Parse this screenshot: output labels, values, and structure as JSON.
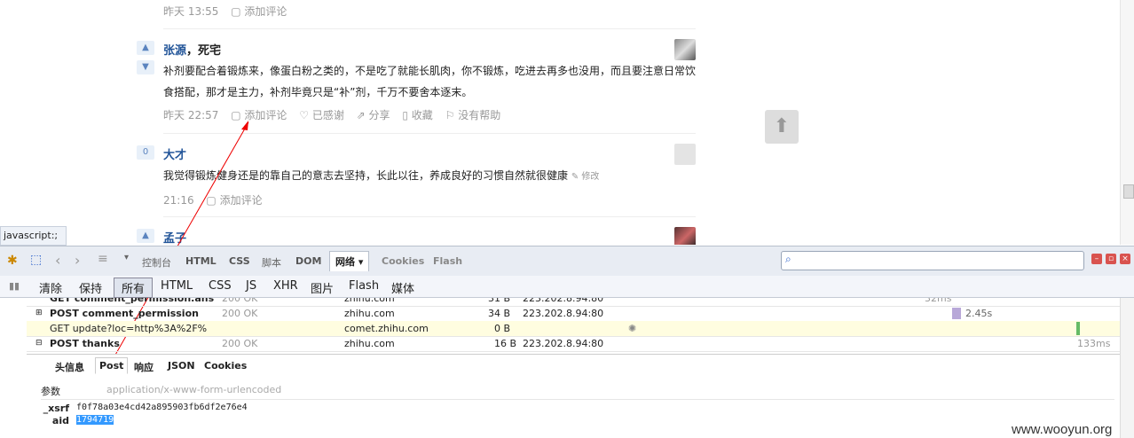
{
  "answers": [
    {
      "time": "昨天 13:55",
      "add_comment": "添加评论"
    },
    {
      "vote": "",
      "author": "张源",
      "bio": "，死宅",
      "text": "补剂要配合着锻炼来，像蛋白粉之类的，不是吃了就能长肌肉，你不锻炼，吃进去再多也没用，而且要注意日常饮食搭配，那才是主力，补剂毕竟只是“补”剂，千万不要舍本逐末。",
      "time": "昨天 22:57",
      "add_comment": "添加评论",
      "thanked": "已感谢",
      "share": "分享",
      "collect": "收藏",
      "no_help": "没有帮助"
    },
    {
      "vote": "0",
      "author": "大才",
      "text": "我觉得锻炼健身还是的靠自己的意志去坚持，长此以往，养成良好的习惯自然就很健康",
      "edit": "修改",
      "time": "21:16",
      "add_comment": "添加评论"
    },
    {
      "author": "孟子"
    }
  ],
  "status_bar": "javascript:;",
  "firebug": {
    "tabs": [
      "控制台",
      "HTML",
      "CSS",
      "脚本",
      "DOM",
      "网络",
      "Cookies",
      "Flash"
    ],
    "active_tab": "网络",
    "net_filters": [
      "清除",
      "保持",
      "所有",
      "HTML",
      "CSS",
      "JS",
      "XHR",
      "图片",
      "Flash",
      "媒体"
    ],
    "active_filter": "所有",
    "requests": [
      {
        "url": "GET comment_permission.ans",
        "status": "200 OK",
        "domain": "zhihu.com",
        "size": "31 B",
        "ip": "223.202.8.94:80",
        "time": "32ms"
      },
      {
        "url": "POST comment_permission",
        "status": "200 OK",
        "domain": "zhihu.com",
        "size": "34 B",
        "ip": "223.202.8.94:80",
        "time": "2.45s"
      },
      {
        "url": "GET update?loc=http%3A%2F%",
        "status": "",
        "domain": "comet.zhihu.com",
        "size": "0 B",
        "ip": "",
        "time": ""
      },
      {
        "url": "POST thanks",
        "status": "200 OK",
        "domain": "zhihu.com",
        "size": "16 B",
        "ip": "223.202.8.94:80",
        "time": "133ms"
      }
    ],
    "detail_tabs": [
      "头信息",
      "Post",
      "响应",
      "JSON",
      "Cookies"
    ],
    "active_detail_tab": "Post",
    "params_label": "参数",
    "content_type": "application/x-www-form-urlencoded",
    "params": [
      {
        "name": "_xsrf",
        "value": "f0f78a03e4cd42a895903fb6df2e76e4"
      },
      {
        "name": "aid",
        "value": "1794719"
      }
    ]
  },
  "watermark": "www.wooyun.org"
}
